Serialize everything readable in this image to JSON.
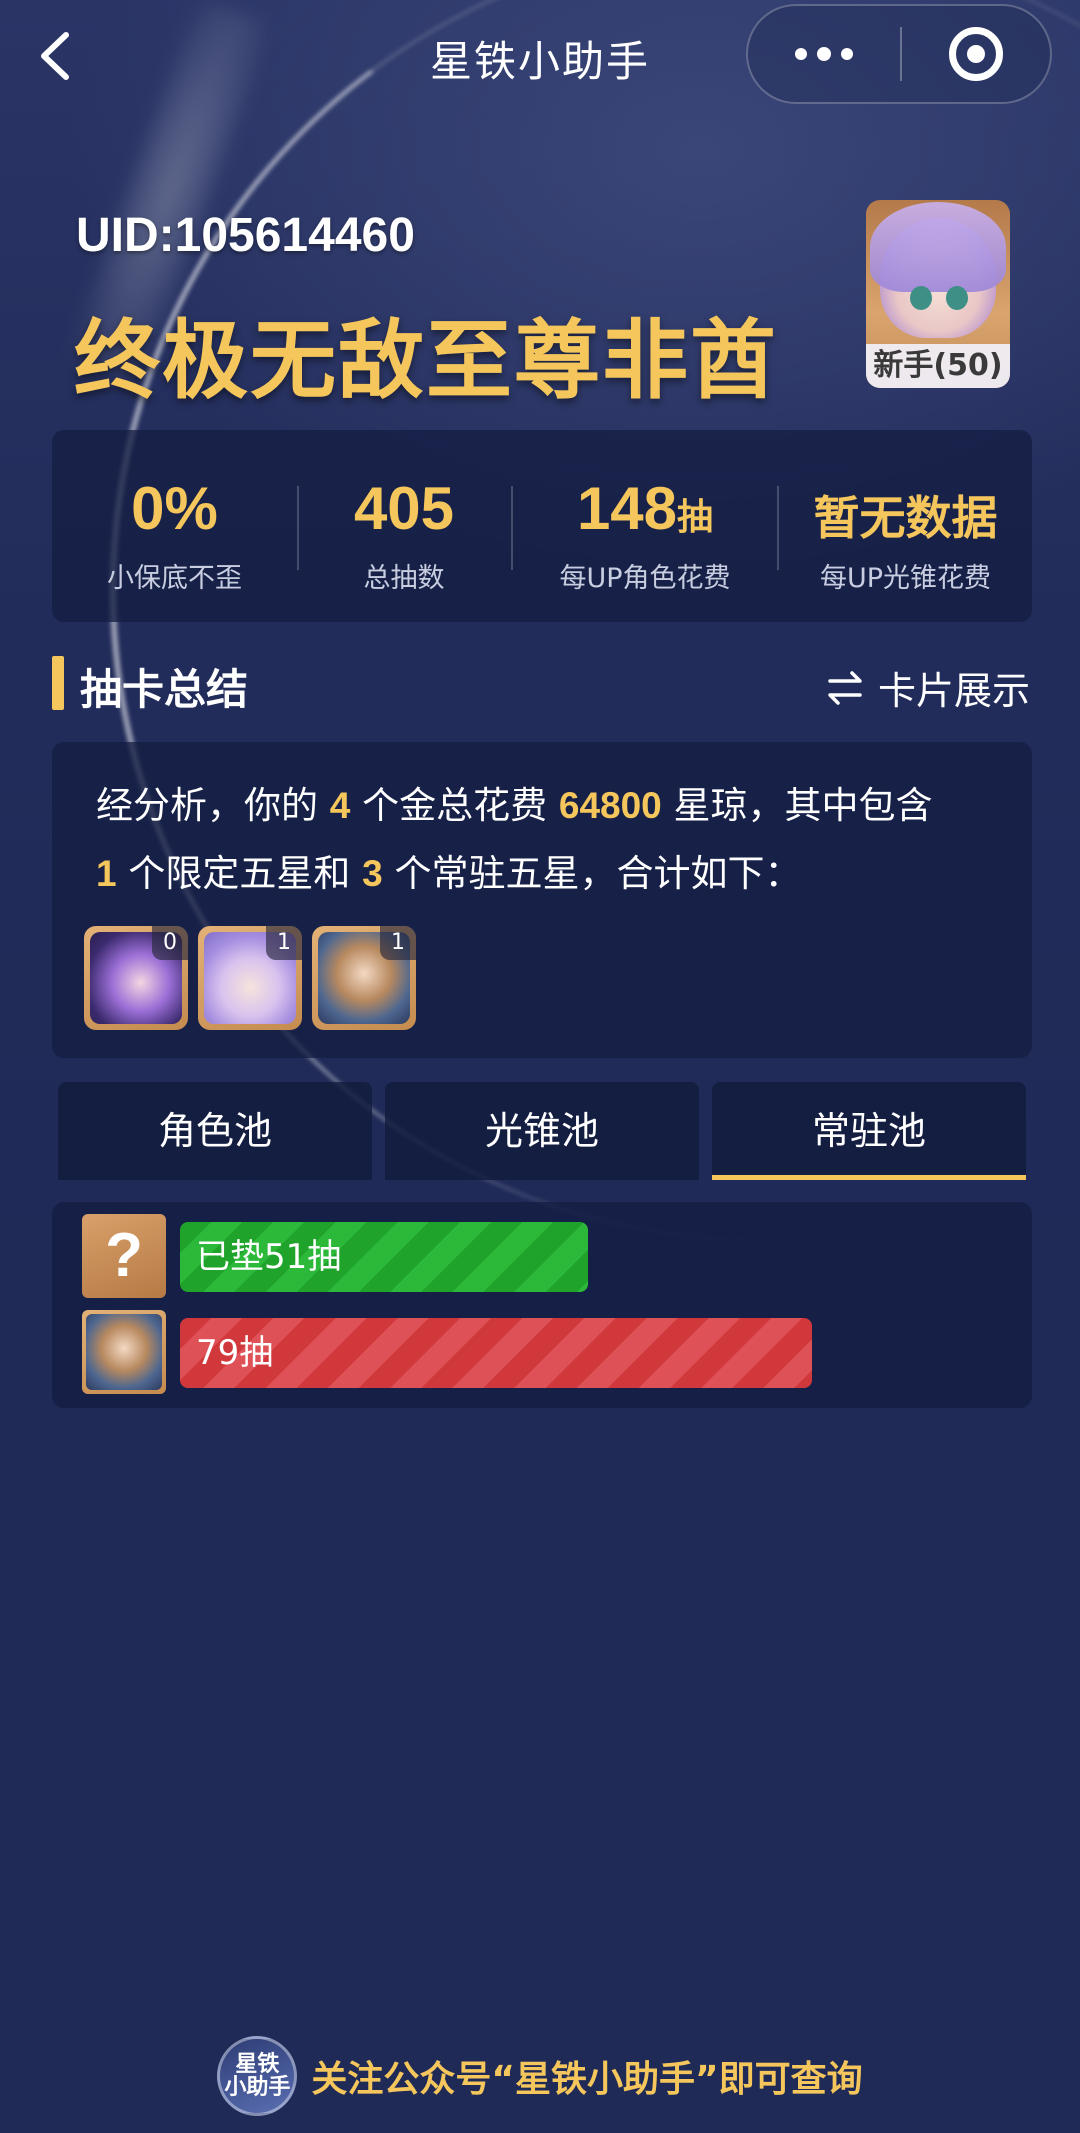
{
  "nav": {
    "title": "星铁小助手"
  },
  "profile": {
    "uid": "UID:105614460",
    "nickname": "终极无敌至尊非酋",
    "avatar_badge": "新手(50)"
  },
  "stats": [
    {
      "value": "0%",
      "label": "小保底不歪"
    },
    {
      "value": "405",
      "label": "总抽数"
    },
    {
      "value": "148",
      "unit": "抽",
      "label": "每UP角色花费"
    },
    {
      "value": "暂无数据",
      "label": "每UP光锥花费"
    }
  ],
  "section": {
    "title": "抽卡总结",
    "toggle_label": "卡片展示"
  },
  "summary": {
    "line1_pre": "经分析，你的",
    "gold_count": "4",
    "line1_mid": "个金总花费",
    "cost": "64800",
    "line1_post": "星琼，其中包含",
    "limited_count": "1",
    "line2_mid": "个限定五星和",
    "standard_count": "3",
    "line2_post": "个常驻五星，合计如下：",
    "thumbs": [
      {
        "count": "0"
      },
      {
        "count": "1"
      },
      {
        "count": "1"
      }
    ]
  },
  "tabs": [
    {
      "label": "角色池"
    },
    {
      "label": "光锥池"
    },
    {
      "label": "常驻池"
    }
  ],
  "active_tab": "常驻池",
  "pulls": [
    {
      "icon": "?",
      "label": "已垫51抽",
      "value": 51,
      "color": "#1fa32a"
    },
    {
      "icon": "character",
      "label": "79抽",
      "value": 79,
      "color": "#d0383c"
    }
  ],
  "footer": {
    "logo_line1": "星铁",
    "logo_line2": "小助手",
    "text": "关注公众号“星铁小助手”即可查询"
  }
}
